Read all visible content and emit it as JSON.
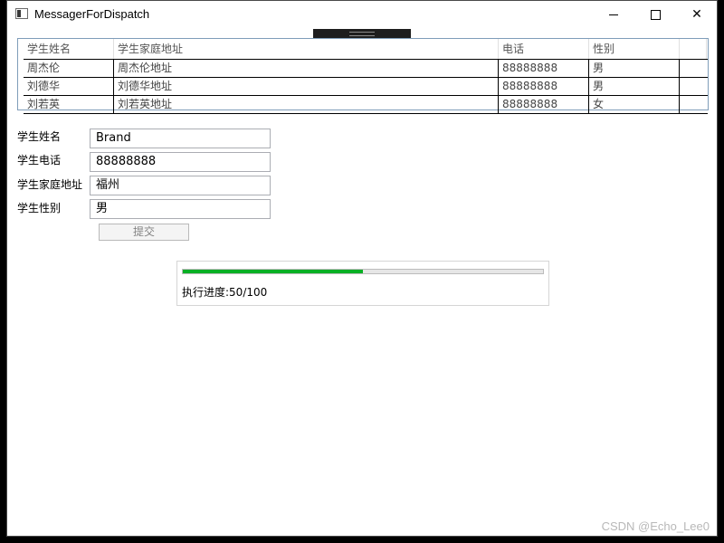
{
  "window": {
    "title": "MessagerForDispatch",
    "controls": {
      "minimize": "—",
      "maximize": "☐",
      "close": "✕"
    }
  },
  "grid": {
    "columns": [
      "学生姓名",
      "学生家庭地址",
      "电话",
      "性别"
    ],
    "rows": [
      {
        "name": "周杰伦",
        "address": "周杰伦地址",
        "phone": "88888888",
        "gender": "男"
      },
      {
        "name": "刘德华",
        "address": "刘德华地址",
        "phone": "88888888",
        "gender": "男"
      },
      {
        "name": "刘若英",
        "address": "刘若英地址",
        "phone": "88888888",
        "gender": "女"
      }
    ]
  },
  "form": {
    "name_label": "学生姓名",
    "name_value": "Brand",
    "phone_label": "学生电话",
    "phone_value": "88888888",
    "address_label": "学生家庭地址",
    "address_value": "福州",
    "gender_label": "学生性别",
    "gender_value": "男",
    "submit_label": "提交"
  },
  "progress": {
    "value": 50,
    "max": 100,
    "text": "执行进度:50/100",
    "fill_color": "#06b025"
  },
  "watermark": "CSDN @Echo_Lee0"
}
